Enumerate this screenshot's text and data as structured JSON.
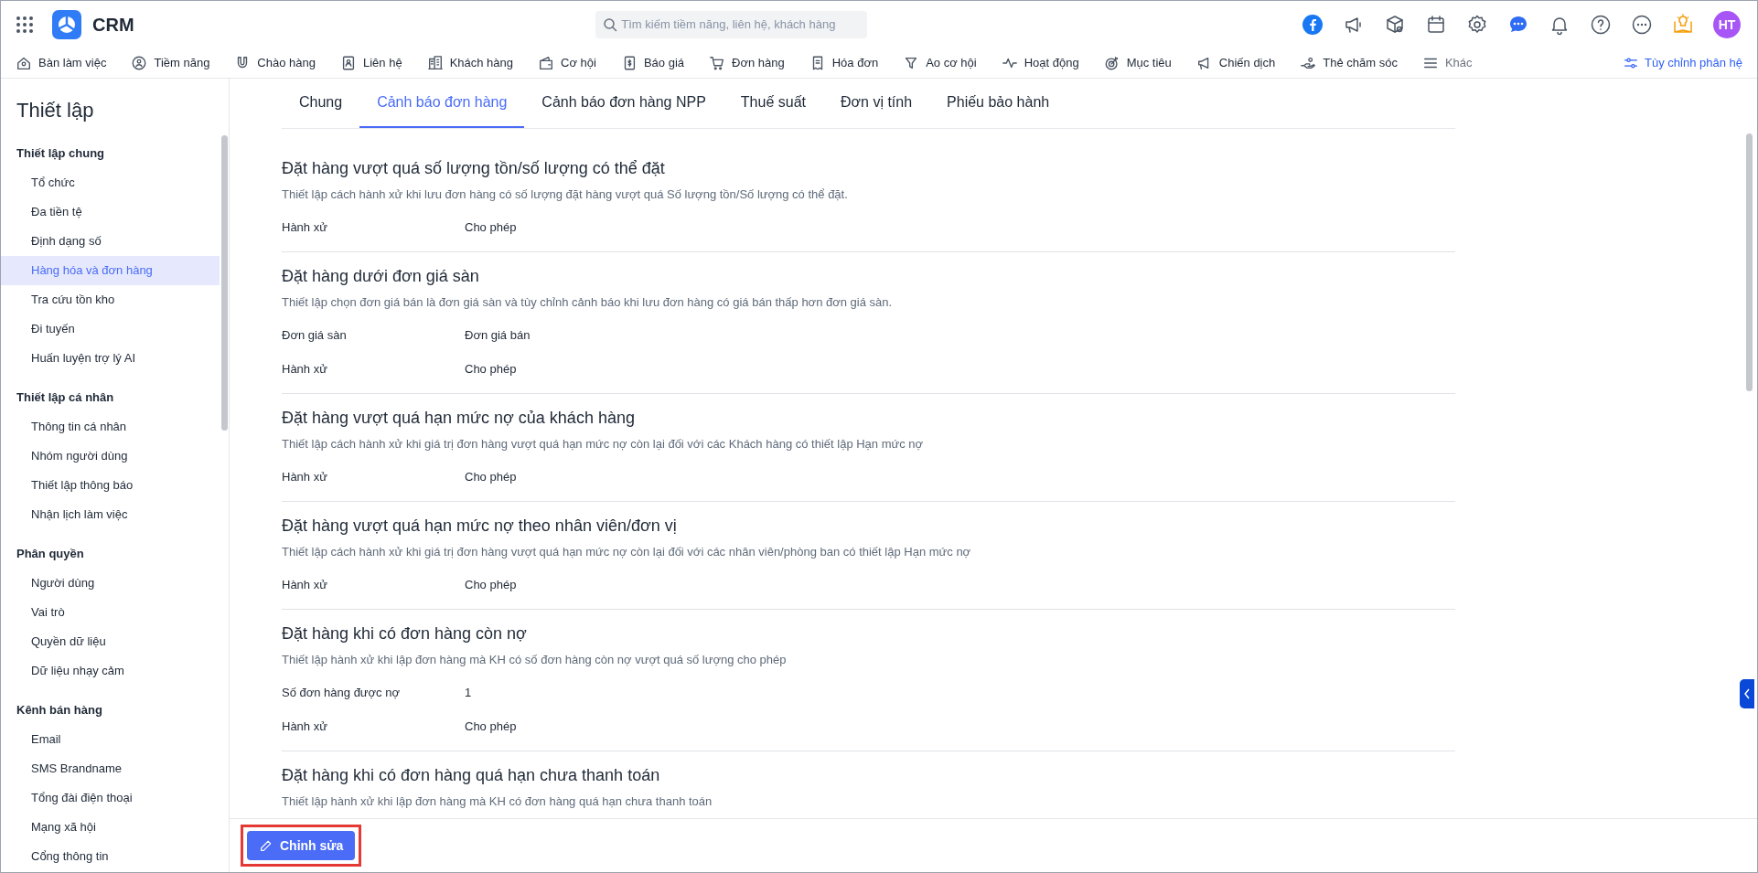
{
  "app": {
    "title": "CRM",
    "search_placeholder": "Tìm kiếm tiềm năng, liên hệ, khách hàng",
    "avatar_initials": "HT"
  },
  "nav": {
    "items": [
      "Bàn làm việc",
      "Tiềm năng",
      "Chào hàng",
      "Liên hệ",
      "Khách hàng",
      "Cơ hội",
      "Báo giá",
      "Đơn hàng",
      "Hóa đơn",
      "Ao cơ hội",
      "Hoạt động",
      "Mục tiêu",
      "Chiến dịch",
      "Thẻ chăm sóc",
      "Khác"
    ],
    "customize": "Tùy chỉnh phân hệ"
  },
  "sidebar": {
    "title": "Thiết lập",
    "groups": [
      {
        "label": "Thiết lập chung",
        "items": [
          {
            "label": "Tổ chức",
            "selected": false
          },
          {
            "label": "Đa tiền tệ",
            "selected": false
          },
          {
            "label": "Định dạng số",
            "selected": false
          },
          {
            "label": "Hàng hóa và đơn hàng",
            "selected": true
          },
          {
            "label": "Tra cứu tồn kho",
            "selected": false
          },
          {
            "label": "Đi tuyến",
            "selected": false
          },
          {
            "label": "Huấn luyện trợ lý AI",
            "selected": false
          }
        ]
      },
      {
        "label": "Thiết lập cá nhân",
        "items": [
          {
            "label": "Thông tin cá nhân",
            "selected": false
          },
          {
            "label": "Nhóm người dùng",
            "selected": false
          },
          {
            "label": "Thiết lập thông báo",
            "selected": false
          },
          {
            "label": "Nhận lịch làm việc",
            "selected": false
          }
        ]
      },
      {
        "label": "Phân quyền",
        "items": [
          {
            "label": "Người dùng",
            "selected": false
          },
          {
            "label": "Vai trò",
            "selected": false
          },
          {
            "label": "Quyền dữ liệu",
            "selected": false
          },
          {
            "label": "Dữ liệu nhạy cảm",
            "selected": false
          }
        ]
      },
      {
        "label": "Kênh bán hàng",
        "items": [
          {
            "label": "Email",
            "selected": false
          },
          {
            "label": "SMS Brandname",
            "selected": false
          },
          {
            "label": "Tổng đài điện thoại",
            "selected": false
          },
          {
            "label": "Mạng xã hội",
            "selected": false
          },
          {
            "label": "Cổng thông tin",
            "selected": false
          }
        ]
      }
    ]
  },
  "tabs": [
    {
      "label": "Chung",
      "selected": false
    },
    {
      "label": "Cảnh báo đơn hàng",
      "selected": true
    },
    {
      "label": "Cảnh báo đơn hàng NPP",
      "selected": false
    },
    {
      "label": "Thuế suất",
      "selected": false
    },
    {
      "label": "Đơn vị tính",
      "selected": false
    },
    {
      "label": "Phiếu bảo hành",
      "selected": false
    }
  ],
  "sections": [
    {
      "title": "Đặt hàng vượt quá số lượng tồn/số lượng có thể đặt",
      "description": "Thiết lập cách hành xử khi lưu đơn hàng có số lượng đặt hàng vượt quá Số lượng tồn/Số lượng có thể đặt.",
      "rows": [
        {
          "label": "Hành xử",
          "value": "Cho phép"
        }
      ]
    },
    {
      "title": "Đặt hàng dưới đơn giá sàn",
      "description": "Thiết lập chọn đơn giá bán là đơn giá sàn và tùy chỉnh cảnh báo khi lưu đơn hàng có giá bán thấp hơn đơn giá sàn.",
      "rows": [
        {
          "label": "Đơn giá sàn",
          "value": "Đơn giá bán"
        },
        {
          "label": "Hành xử",
          "value": "Cho phép"
        }
      ]
    },
    {
      "title": "Đặt hàng vượt quá hạn mức nợ của khách hàng",
      "description": "Thiết lập cách hành xử khi giá trị đơn hàng vượt quá hạn mức nợ còn lại đối với các Khách hàng có thiết lập Hạn mức nợ",
      "rows": [
        {
          "label": "Hành xử",
          "value": "Cho phép"
        }
      ]
    },
    {
      "title": "Đặt hàng vượt quá hạn mức nợ theo nhân viên/đơn vị",
      "description": "Thiết lập cách hành xử khi giá trị đơn hàng vượt quá hạn mức nợ còn lại đối với các nhân viên/phòng ban có thiết lập Hạn mức nợ",
      "rows": [
        {
          "label": "Hành xử",
          "value": "Cho phép"
        }
      ]
    },
    {
      "title": "Đặt hàng khi có đơn hàng còn nợ",
      "description": "Thiết lập hành xử khi lập đơn hàng mà KH có số đơn hàng còn nợ vượt quá số lượng cho phép",
      "rows": [
        {
          "label": "Số đơn hàng được nợ",
          "value": "1"
        },
        {
          "label": "Hành xử",
          "value": "Cho phép"
        }
      ]
    },
    {
      "title": "Đặt hàng khi có đơn hàng quá hạn chưa thanh toán",
      "description": "Thiết lập hành xử khi lập đơn hàng mà KH có đơn hàng quá hạn chưa thanh toán"
    }
  ],
  "edit_button": "Chỉnh sửa"
}
